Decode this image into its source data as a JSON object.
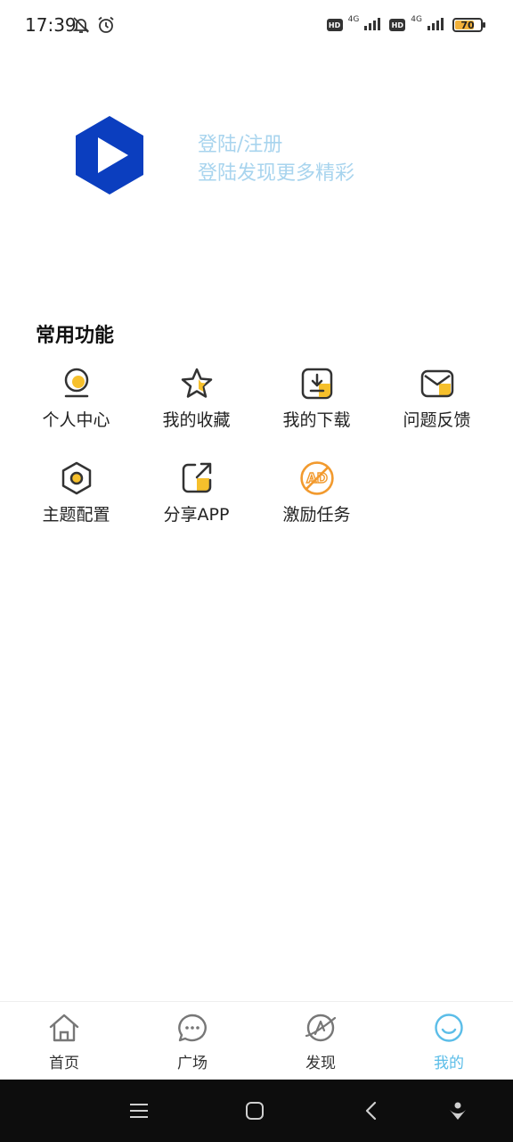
{
  "status_bar": {
    "time": "17:39",
    "network_1": "4G",
    "network_2": "4G",
    "hd_label": "HD",
    "battery": "70",
    "battery_level": 0.7
  },
  "profile": {
    "login_title": "登陆/注册",
    "login_subtitle": "登陆发现更多精彩"
  },
  "functions": {
    "title": "常用功能",
    "items": [
      {
        "label": "个人中心",
        "icon": "user-center-icon"
      },
      {
        "label": "我的收藏",
        "icon": "star-icon"
      },
      {
        "label": "我的下载",
        "icon": "download-icon"
      },
      {
        "label": "问题反馈",
        "icon": "feedback-mail-icon"
      },
      {
        "label": "主题配置",
        "icon": "theme-settings-icon"
      },
      {
        "label": "分享APP",
        "icon": "share-icon"
      },
      {
        "label": "激励任务",
        "icon": "ad-task-icon"
      }
    ]
  },
  "tabs": [
    {
      "label": "首页",
      "icon": "home-icon",
      "active": false
    },
    {
      "label": "广场",
      "icon": "chat-bubble-icon",
      "active": false
    },
    {
      "label": "发现",
      "icon": "planet-icon",
      "active": false
    },
    {
      "label": "我的",
      "icon": "smile-face-icon",
      "active": true
    }
  ],
  "colors": {
    "accent": "#5bbde8",
    "login_text": "#a8d4ee",
    "logo_blue": "#0b3ebf",
    "icon_yellow": "#f6c02c",
    "icon_orange": "#f29a2e"
  }
}
